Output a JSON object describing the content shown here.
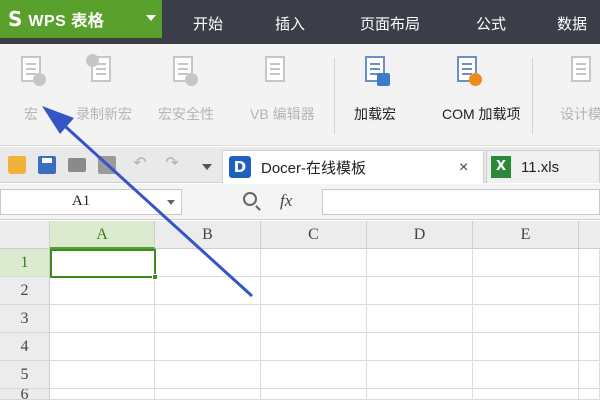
{
  "menubar": {
    "app_logo": "S",
    "app_title": "WPS 表格",
    "tabs": [
      "开始",
      "插入",
      "页面布局",
      "公式",
      "数据"
    ]
  },
  "ribbon": {
    "buttons": [
      {
        "label": "宏",
        "icon": "macro-icon",
        "enabled": false
      },
      {
        "label": "录制新宏",
        "icon": "record-macro-icon",
        "enabled": false
      },
      {
        "label": "宏安全性",
        "icon": "macro-security-icon",
        "enabled": false
      },
      {
        "label": "VB 编辑器",
        "icon": "vb-editor-icon",
        "enabled": false
      },
      {
        "label": "加载宏",
        "icon": "addin-icon",
        "enabled": true
      },
      {
        "label": "COM 加载项",
        "icon": "com-addin-icon",
        "enabled": true
      },
      {
        "label": "设计模",
        "icon": "design-mode-icon",
        "enabled": false
      }
    ]
  },
  "quickbar": {
    "tabs": [
      {
        "label": "Docer-在线模板",
        "icon": "D",
        "close": "×"
      },
      {
        "label": "11.xls",
        "icon": "X"
      }
    ]
  },
  "formula": {
    "cell_ref": "A1",
    "fx_label": "fx",
    "value": ""
  },
  "grid": {
    "columns": [
      "A",
      "B",
      "C",
      "D",
      "E"
    ],
    "rows": [
      "1",
      "2",
      "3",
      "4",
      "5",
      "6"
    ],
    "active_cell": "A1"
  },
  "colors": {
    "app_green": "#5aa02c",
    "menubar_bg": "#3b3e48",
    "arrow_blue": "#3355c7"
  }
}
